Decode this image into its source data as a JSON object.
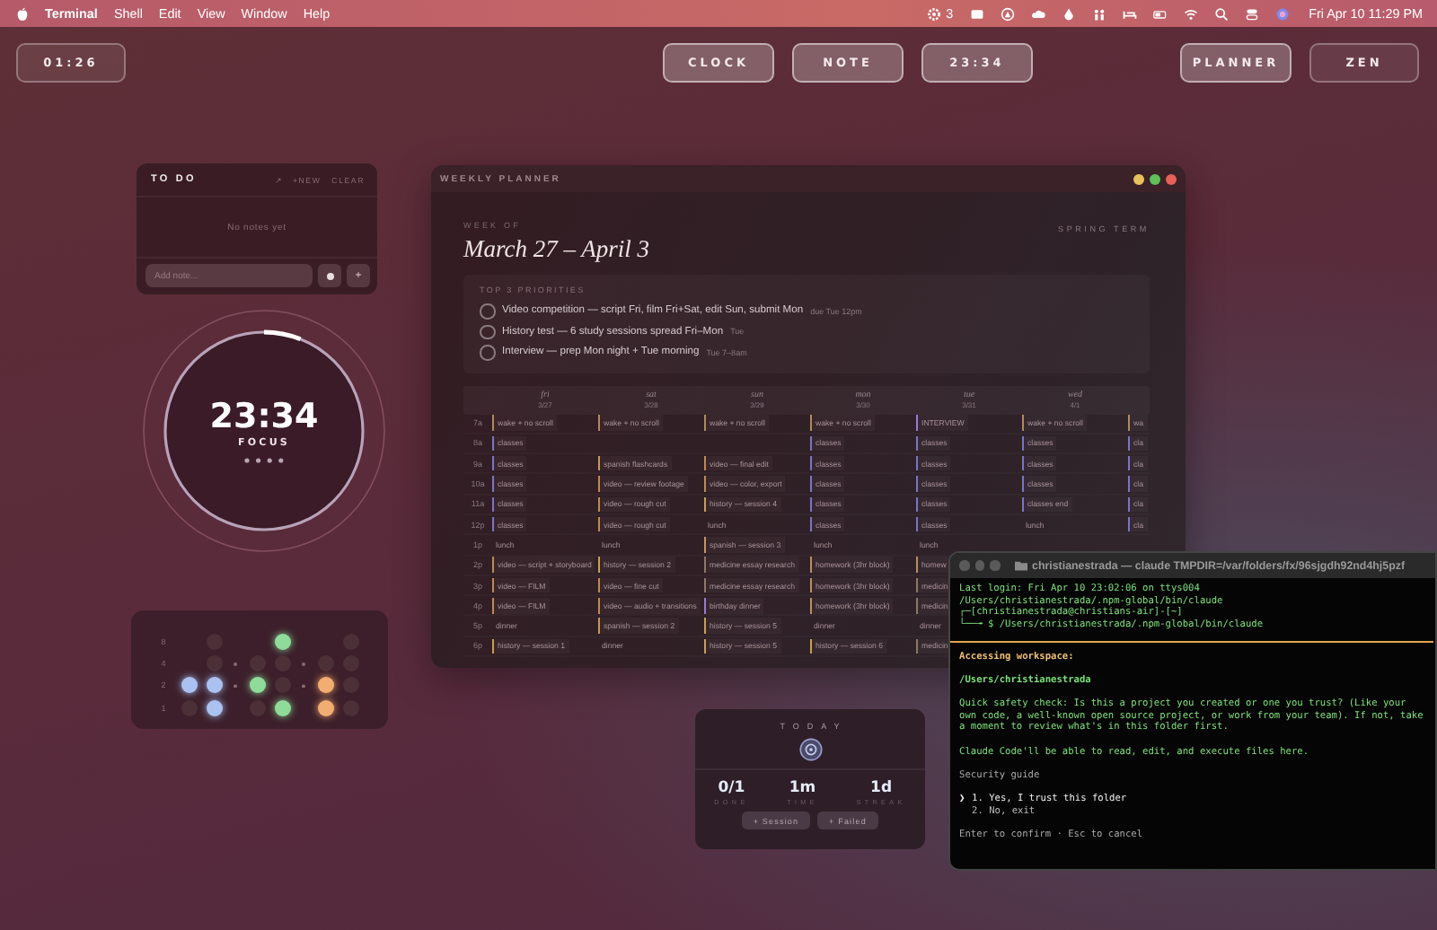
{
  "menu_bar": {
    "app": "Terminal",
    "menus": [
      "Shell",
      "Edit",
      "View",
      "Window",
      "Help"
    ],
    "status_count": "3",
    "clock": "Fri Apr 10  11:29 PM"
  },
  "top_buttons": [
    {
      "label": "01:26",
      "active": false
    },
    {
      "label": "CLOCK",
      "active": true
    },
    {
      "label": "NOTE",
      "active": true
    },
    {
      "label": "23:34",
      "active": true
    },
    {
      "label": "PLANNER",
      "active": true
    },
    {
      "label": "ZEN",
      "active": false
    }
  ],
  "todo": {
    "title": "TO DO",
    "actions": [
      "↗",
      "+NEW",
      "CLEAR"
    ],
    "empty_text": "No notes yet",
    "input": {
      "placeholder": "Add note..."
    },
    "add_button": "+"
  },
  "focus": {
    "time": "23:34",
    "label": "FOCUS",
    "level": 0.06
  },
  "binary_clock": {
    "row_labels": [
      "8",
      "4",
      "2",
      "1"
    ],
    "groups": [
      {
        "color": "#a9c2f2",
        "columns": [
          {
            "bits": [
              true,
              false
            ]
          },
          {
            "bits": [
              false,
              false,
              true,
              true
            ]
          }
        ]
      },
      {
        "color": "#8fdc9a",
        "columns": [
          {
            "bits": [
              false,
              true,
              false
            ]
          },
          {
            "bits": [
              true,
              false,
              false,
              true
            ]
          }
        ]
      },
      {
        "color": "#f2ad70",
        "columns": [
          {
            "bits": [
              false,
              true,
              true
            ]
          },
          {
            "bits": [
              false,
              false,
              false,
              false
            ]
          }
        ]
      }
    ]
  },
  "planner": {
    "title": "WEEKLY PLANNER",
    "week_label": "WEEK OF",
    "week_range": "March 27 – April 3",
    "term": "SPRING TERM",
    "priorities_title": "TOP 3 PRIORITIES",
    "priorities": [
      {
        "text": "Video competition — script Fri, film Fri+Sat, edit Sun, submit Mon",
        "due": "due Tue 12pm",
        "checked": false
      },
      {
        "text": "History test — 6 study sessions spread Fri–Mon",
        "due": "Tue",
        "checked": false
      },
      {
        "text": "Interview — prep Mon night + Tue morning",
        "due": "Tue 7–8am",
        "checked": false
      }
    ],
    "days": [
      {
        "name": "fri",
        "date": "3/27"
      },
      {
        "name": "sat",
        "date": "3/28"
      },
      {
        "name": "sun",
        "date": "3/29"
      },
      {
        "name": "mon",
        "date": "3/30"
      },
      {
        "name": "tue",
        "date": "3/31"
      },
      {
        "name": "wed",
        "date": "4/1"
      }
    ],
    "rows": [
      {
        "hour": "7a",
        "cells": [
          {
            "text": "wake + no scroll",
            "color": "#b08a5c"
          },
          {
            "text": "wake + no scroll",
            "color": "#b08a5c"
          },
          {
            "text": "wake + no scroll",
            "color": "#b08a5c"
          },
          {
            "text": "wake + no scroll",
            "color": "#b08a5c"
          },
          {
            "text": "INTERVIEW",
            "color": "#9a78d8"
          },
          {
            "text": "wake + no scroll",
            "color": "#b08a5c"
          },
          {
            "text": "wa",
            "color": "#b08a5c"
          }
        ]
      },
      {
        "hour": "8a",
        "cells": [
          {
            "text": "classes",
            "color": "#7a74c8"
          },
          {},
          {},
          {
            "text": "classes",
            "color": "#7a74c8"
          },
          {
            "text": "classes",
            "color": "#7a74c8"
          },
          {
            "text": "classes",
            "color": "#7a74c8"
          },
          {
            "text": "cla",
            "color": "#7a74c8"
          }
        ]
      },
      {
        "hour": "9a",
        "cells": [
          {
            "text": "classes",
            "color": "#7a74c8"
          },
          {
            "text": "spanish flashcards",
            "color": "#c8955a"
          },
          {
            "text": "video — final edit",
            "color": "#c08a50"
          },
          {
            "text": "classes",
            "color": "#7a74c8"
          },
          {
            "text": "classes",
            "color": "#7a74c8"
          },
          {
            "text": "classes",
            "color": "#7a74c8"
          },
          {
            "text": "cla",
            "color": "#7a74c8"
          }
        ]
      },
      {
        "hour": "10a",
        "cells": [
          {
            "text": "classes",
            "color": "#7a74c8"
          },
          {
            "text": "video — review footage",
            "color": "#c08a50"
          },
          {
            "text": "video — color, export",
            "color": "#c08a50"
          },
          {
            "text": "classes",
            "color": "#7a74c8"
          },
          {
            "text": "classes",
            "color": "#7a74c8"
          },
          {
            "text": "classes",
            "color": "#7a74c8"
          },
          {
            "text": "cla",
            "color": "#7a74c8"
          }
        ]
      },
      {
        "hour": "11a",
        "cells": [
          {
            "text": "classes",
            "color": "#7a74c8"
          },
          {
            "text": "video — rough cut",
            "color": "#c08a50"
          },
          {
            "text": "history — session 4",
            "color": "#c9a14a"
          },
          {
            "text": "classes",
            "color": "#7a74c8"
          },
          {
            "text": "classes",
            "color": "#7a74c8"
          },
          {
            "text": "classes end",
            "color": "#7a74c8"
          },
          {
            "text": "cla",
            "color": "#7a74c8"
          }
        ]
      },
      {
        "hour": "12p",
        "cells": [
          {
            "text": "classes",
            "color": "#7a74c8"
          },
          {
            "text": "video — rough cut",
            "color": "#c08a50"
          },
          {
            "text": "lunch"
          },
          {
            "text": "classes",
            "color": "#7a74c8"
          },
          {
            "text": "classes",
            "color": "#7a74c8"
          },
          {
            "text": "lunch"
          },
          {
            "text": "cla",
            "color": "#7a74c8"
          }
        ]
      },
      {
        "hour": "1p",
        "cells": [
          {
            "text": "lunch"
          },
          {
            "text": "lunch"
          },
          {
            "text": "spanish — session 3",
            "color": "#c8955a"
          },
          {
            "text": "lunch"
          },
          {
            "text": "lunch"
          }
        ]
      },
      {
        "hour": "2p",
        "cells": [
          {
            "text": "video — script + storyboard",
            "color": "#c08a50"
          },
          {
            "text": "history — session 2",
            "color": "#c9a14a"
          },
          {
            "text": "medicine essay research",
            "color": "#8c7868"
          },
          {
            "text": "homework (3hr block)",
            "color": "#b89060"
          },
          {
            "text": "homew",
            "color": "#b89060"
          }
        ]
      },
      {
        "hour": "3p",
        "cells": [
          {
            "text": "video — FILM",
            "color": "#c08a50"
          },
          {
            "text": "video — fine cut",
            "color": "#c08a50"
          },
          {
            "text": "medicine essay research",
            "color": "#8c7868"
          },
          {
            "text": "homework (3hr block)",
            "color": "#b89060"
          },
          {
            "text": "medicin",
            "color": "#8c7868"
          }
        ]
      },
      {
        "hour": "4p",
        "cells": [
          {
            "text": "video — FILM",
            "color": "#c08a50"
          },
          {
            "text": "video — audio + transitions",
            "color": "#c08a50"
          },
          {
            "text": "birthday dinner",
            "color": "#9a78d8"
          },
          {
            "text": "homework (3hr block)",
            "color": "#b89060"
          },
          {
            "text": "medicin",
            "color": "#8c7868"
          }
        ]
      },
      {
        "hour": "5p",
        "cells": [
          {
            "text": "dinner"
          },
          {
            "text": "spanish — session 2",
            "color": "#c8955a"
          },
          {
            "text": "history — session 5",
            "color": "#c9a14a"
          },
          {
            "text": "dinner"
          },
          {
            "text": "dinner"
          }
        ]
      },
      {
        "hour": "6p",
        "cells": [
          {
            "text": "history — session 1",
            "color": "#c9a14a"
          },
          {
            "text": "dinner"
          },
          {
            "text": "history — session 5",
            "color": "#c9a14a"
          },
          {
            "text": "history — session 6",
            "color": "#c9a14a"
          },
          {
            "text": "medicin",
            "color": "#8c7868"
          }
        ]
      }
    ]
  },
  "terminal": {
    "title": "christianestrada — claude TMPDIR=/var/folders/fx/96sjgdh92nd4hj5pzf",
    "login_lines": [
      "Last login: Fri Apr 10 23:02:06 on ttys004",
      "/Users/christianestrada/.npm-global/bin/claude",
      "┌─[christianestrada@christians-air]-[~]",
      "└──╼ $ /Users/christianestrada/.npm-global/bin/claude"
    ],
    "heading": "Accessing workspace:",
    "path": "/Users/christianestrada",
    "paragraphs": [
      "Quick safety check: Is this a project you created or one you trust? (Like your own code, a well-known open source project, or work from your team). If not, take a moment to review what's in this folder first.",
      "Claude Code'll be able to read, edit, and execute files here."
    ],
    "guide": "Security guide",
    "pointer": "❯",
    "options": [
      {
        "text": "1. Yes, I trust this folder",
        "selected": true
      },
      {
        "text": "2. No, exit",
        "selected": false
      }
    ],
    "hint": "Enter to confirm · Esc to cancel"
  },
  "today": {
    "title": "TODAY",
    "stats": [
      {
        "value": "0/1",
        "label": "DONE"
      },
      {
        "value": "1m",
        "label": "TIME"
      },
      {
        "value": "1d",
        "label": "STREAK"
      }
    ],
    "buttons": [
      "+ Session",
      "+ Failed"
    ]
  }
}
